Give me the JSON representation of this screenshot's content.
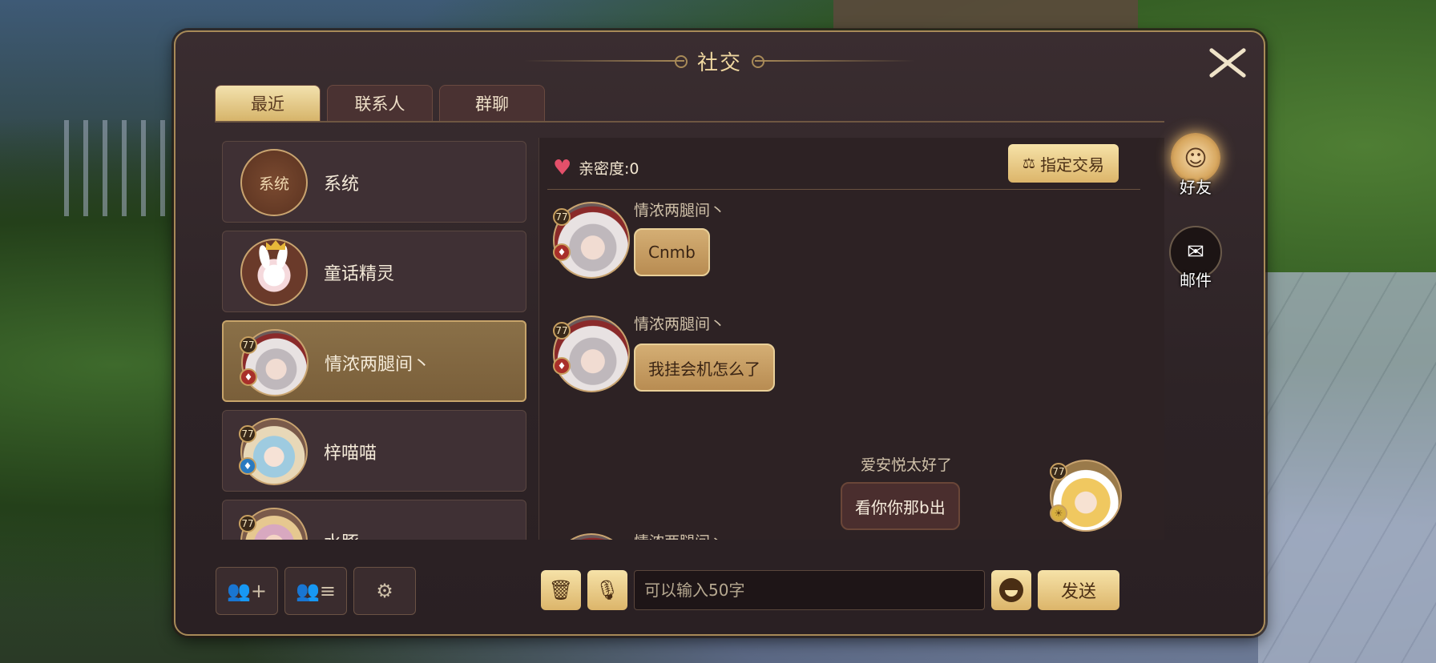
{
  "panel": {
    "title": "社交"
  },
  "tabs": [
    {
      "label": "最近",
      "active": true
    },
    {
      "label": "联系人",
      "active": false
    },
    {
      "label": "群聊",
      "active": false
    }
  ],
  "contacts": [
    {
      "name": "系统",
      "avatar_text": "系统"
    },
    {
      "name": "童话精灵"
    },
    {
      "name": "情浓两腿间丶",
      "level": "77",
      "active": true
    },
    {
      "name": "梓喵喵",
      "level": "77"
    },
    {
      "name": "水豚",
      "level": "77"
    }
  ],
  "chat": {
    "intimacy_label": "亲密度:0",
    "trade_button": "指定交易",
    "messages": [
      {
        "sender": "情浓两腿间丶",
        "text": "Cnmb",
        "level": "77"
      },
      {
        "sender": "情浓两腿间丶",
        "text": "我挂会机怎么了",
        "level": "77"
      },
      {
        "sender": "爱安悦太好了",
        "text": "看你你那b出",
        "level": "77",
        "mine": true
      },
      {
        "sender": "情浓两腿间丶"
      }
    ]
  },
  "input": {
    "placeholder": "可以输入50字",
    "value": ""
  },
  "send_button": "发送",
  "side_nav": [
    {
      "label": "好友",
      "icon": "friend-icon"
    },
    {
      "label": "邮件",
      "icon": "mail-icon"
    }
  ],
  "colors": {
    "accent": "#dcb56a",
    "panel_bg": "#2d2326",
    "heart": "#e4506a"
  }
}
